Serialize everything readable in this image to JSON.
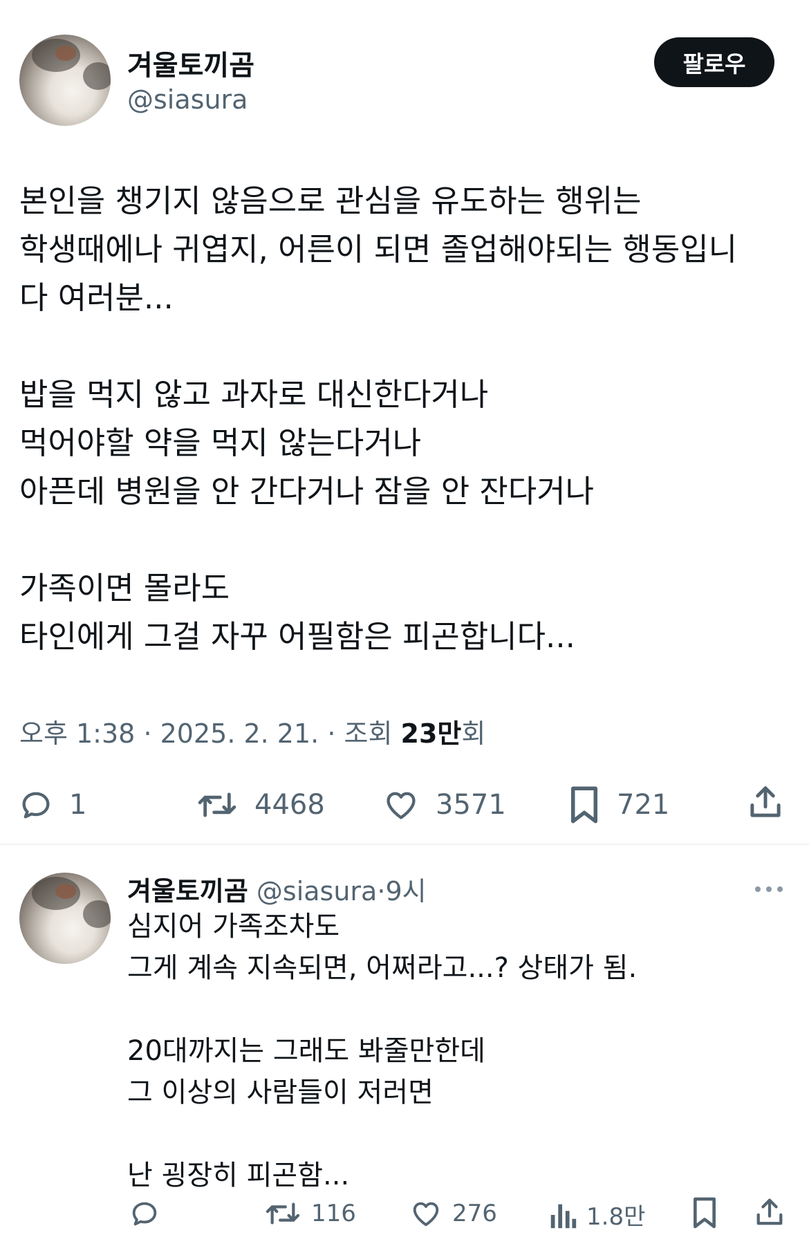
{
  "tweet": {
    "author_name": "겨울토끼곰",
    "author_handle": "@siasura",
    "follow_label": "팔로우",
    "body_lines": [
      "본인을 챙기지 않음으로 관심을 유도하는 행위는",
      "학생때에나 귀엽지, 어른이 되면 졸업해야되는 행동입니",
      "다 여러분...",
      "",
      "밥을 먹지 않고 과자로 대신한다거나",
      "먹어야할 약을 먹지 않는다거나",
      "아픈데 병원을 안 간다거나 잠을 안 잔다거나",
      "",
      "가족이면 몰라도",
      "타인에게 그걸 자꾸 어필함은 피곤합니다..."
    ],
    "meta": {
      "time": "오후 1:38",
      "date": "2025. 2. 21.",
      "views_prefix": "조회",
      "views_count": "23만",
      "views_suffix": "회",
      "separator": "·"
    },
    "actions": {
      "reply_count": "1",
      "retweet_count": "4468",
      "like_count": "3571",
      "bookmark_count": "721"
    }
  },
  "reply": {
    "author_name": "겨울토끼곰",
    "author_handle": "@siasura",
    "time": "9시",
    "separator": "·",
    "body_lines": [
      "심지어 가족조차도",
      "그게 계속 지속되면, 어쩌라고...? 상태가 됨.",
      "",
      "20대까지는 그래도 봐줄만한데",
      "그 이상의 사람들이 저러면",
      "",
      "난 굉장히 피곤함..."
    ],
    "actions": {
      "retweet_count": "116",
      "like_count": "276",
      "views_count": "1.8만"
    }
  },
  "colors": {
    "text": "#0f1419",
    "secondary": "#536471",
    "divider": "#eff3f4",
    "follow_bg": "#0f1419"
  },
  "icons": [
    "reply-icon",
    "retweet-icon",
    "like-icon",
    "bookmark-icon",
    "share-icon",
    "views-icon",
    "more-icon"
  ]
}
